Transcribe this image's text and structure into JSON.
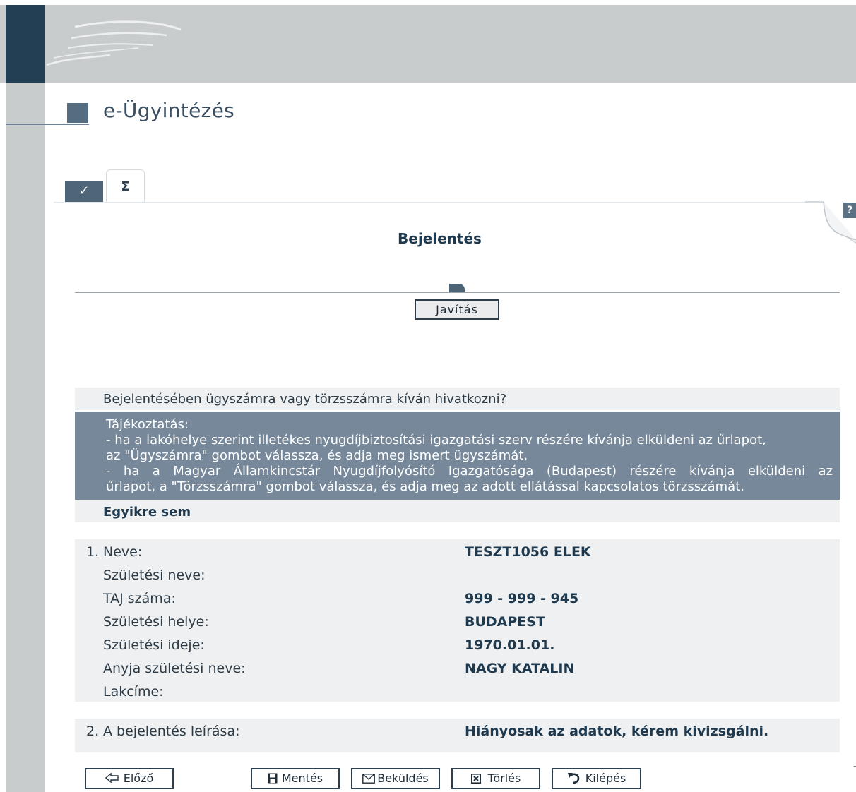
{
  "header": {
    "app_title": "e-Ügyintézés"
  },
  "tabs": [
    {
      "label": "✓"
    },
    {
      "label": "Σ"
    }
  ],
  "help": {
    "label": "?"
  },
  "form": {
    "title": "Bejelentés",
    "edit_button": "Javítás"
  },
  "question": {
    "text": "Bejelentésében ügyszámra vagy törzsszámra kíván hivatkozni?",
    "info_lines": [
      "Tájékoztatás:",
      "- ha a lakóhelye szerint illetékes nyugdíjbiztosítási igazgatási szerv részére kívánja elküldeni az űrlapot,",
      "az \"Ügyszámra\" gombot válassza, és adja meg ismert ügyszámát,",
      "- ha a Magyar Államkincstár Nyugdíjfolyósító Igazgatósága (Budapest) részére kívánja elküldeni az",
      "űrlapot, a \"Törzsszámra\" gombot válassza, és adja meg az adott ellátással kapcsolatos törzsszámát."
    ],
    "selected_choice": "Egyikre sem"
  },
  "person": {
    "number": "1.",
    "rows": [
      {
        "label": "Neve:",
        "value": "TESZT1056 ELEK"
      },
      {
        "label": "Születési neve:",
        "value": ""
      },
      {
        "label": "TAJ száma:",
        "value": "999 - 999 - 945"
      },
      {
        "label": "Születési helye:",
        "value": "BUDAPEST"
      },
      {
        "label": "Születési ideje:",
        "value": "1970.01.01."
      },
      {
        "label": "Anyja születési neve:",
        "value": "NAGY KATALIN"
      },
      {
        "label": "Lakcíme:",
        "value": ""
      }
    ]
  },
  "description": {
    "number": "2.",
    "label": "A bejelentés leírása:",
    "value": "Hiányosak az adatok, kérem kivizsgálni."
  },
  "footer": {
    "prev": "Előző",
    "save": "Mentés",
    "send": "Beküldés",
    "delete": "Törlés",
    "exit": "Kilépés"
  }
}
